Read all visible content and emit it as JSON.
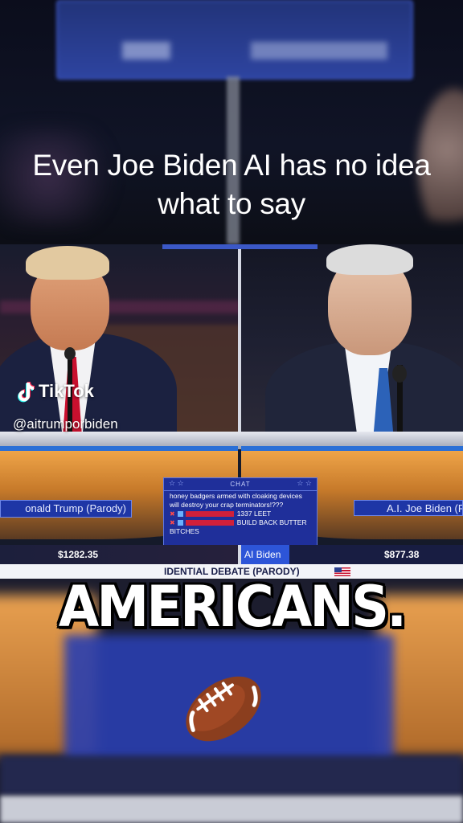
{
  "caption": "Even Joe Biden AI has no idea what to say",
  "watermark": {
    "brand": "TikTok",
    "handle": "@aitrumporbiden"
  },
  "debate": {
    "left_candidate": "onald Trump (Parody)",
    "right_candidate": "A.I. Joe Biden (P",
    "left_amount": "$1282.35",
    "right_amount": "$877.38",
    "ai_label": "AI Biden",
    "ticker": "IDENTIAL DEBATE (PARODY)",
    "chat": {
      "title": "CHAT",
      "lines": [
        "honey badgers armed with cloaking devices",
        "will destroy your crap terminators!???"
      ],
      "messages": [
        {
          "text": "1337 LEET"
        },
        {
          "text": "BUILD BACK BUTTER"
        }
      ],
      "overflow": "BITCHES"
    }
  },
  "overlay_text": "AMERICANS.",
  "overlay_emoji": "🏈",
  "colors": {
    "nameplate_blue": "#1e36a6",
    "chat_blue": "#1f2f9a",
    "ai_label_blue": "#2d55d8"
  }
}
